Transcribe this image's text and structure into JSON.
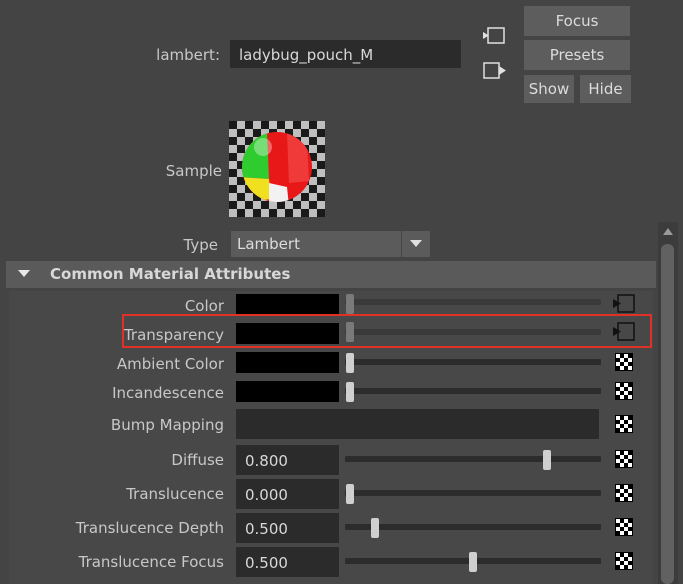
{
  "header": {
    "material_label": "lambert:",
    "material_name": "ladybug_pouch_M",
    "buttons": {
      "focus": "Focus",
      "presets": "Presets",
      "show": "Show",
      "hide": "Hide"
    }
  },
  "sample_label": "Sample",
  "type_label": "Type",
  "type_value": "Lambert",
  "section": {
    "title": "Common Material Attributes"
  },
  "attributes": {
    "color": {
      "label": "Color"
    },
    "transparency": {
      "label": "Transparency"
    },
    "ambient_color": {
      "label": "Ambient Color"
    },
    "incandescence": {
      "label": "Incandescence"
    },
    "bump_mapping": {
      "label": "Bump Mapping"
    },
    "diffuse": {
      "label": "Diffuse",
      "value": "0.800",
      "fraction": 0.8
    },
    "translucence": {
      "label": "Translucence",
      "value": "0.000",
      "fraction": 0.0
    },
    "translucence_depth": {
      "label": "Translucence Depth",
      "value": "0.500",
      "fraction": 0.1
    },
    "translucence_focus": {
      "label": "Translucence Focus",
      "value": "0.500",
      "fraction": 0.5
    }
  },
  "icons": {
    "input_connection": "input-arrow-icon",
    "output_connection": "output-arrow-icon",
    "map_texture": "checker-map-icon",
    "connected_map": "connected-map-icon"
  }
}
